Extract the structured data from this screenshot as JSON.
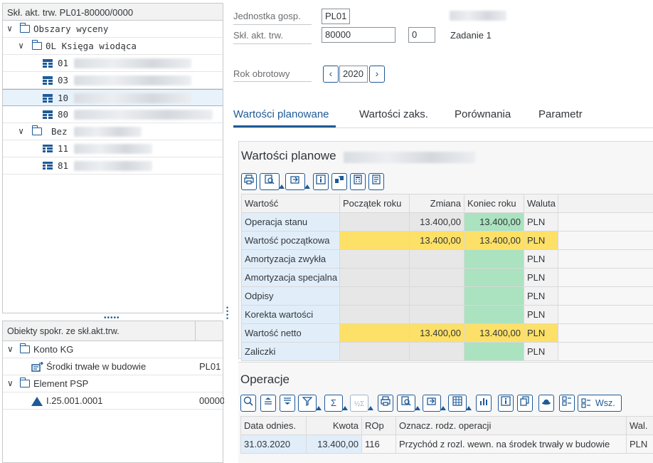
{
  "left": {
    "tree_header": "Skł. akt. trw. PL01-80000/0000",
    "tree": [
      {
        "twisty": "∨",
        "label": "Obszary wyceny"
      },
      {
        "twisty": "∨",
        "label": "0L Księga wiodąca"
      },
      {
        "label": "01"
      },
      {
        "label": "03"
      },
      {
        "label": "10",
        "selected": true
      },
      {
        "label": "80"
      },
      {
        "twisty": "∨",
        "label": "Bez"
      },
      {
        "label": "11"
      },
      {
        "label": "81"
      }
    ],
    "objects_header": "Obiekty spokr. ze skł.akt.trw.",
    "objects": [
      {
        "twisty": "∨",
        "label": "Konto KG"
      },
      {
        "label": "Środki trwałe w budowie",
        "value": "PL01"
      },
      {
        "twisty": "∨",
        "label": "Element PSP"
      },
      {
        "label": "I.25.001.0001",
        "value": "00000"
      }
    ]
  },
  "header": {
    "company_label": "Jednostka gosp.",
    "company_value": "PL01",
    "asset_label": "Skł. akt. trw.",
    "asset_value": "80000",
    "sub_value": "0",
    "task_label": "Zadanie 1",
    "year_label": "Rok obrotowy",
    "year_value": "2020",
    "prev_icon": "chevron-left-icon",
    "next_icon": "chevron-right-icon"
  },
  "tabs": [
    "Wartości planowane",
    "Wartości zaks.",
    "Porównania",
    "Parametr"
  ],
  "planned": {
    "title": "Wartości planowe",
    "columns": [
      "Wartość",
      "Początek roku",
      "Zmiana",
      "Koniec roku",
      "Waluta"
    ],
    "rows": [
      {
        "name": "Operacja stanu",
        "start": "",
        "change": "13.400,00",
        "end": "13.400,00",
        "cur": "PLN",
        "hl": false
      },
      {
        "name": "Wartość początkowa",
        "start": "",
        "change": "13.400,00",
        "end": "13.400,00",
        "cur": "PLN",
        "hl": true
      },
      {
        "name": "Amortyzacja zwykła",
        "start": "",
        "change": "",
        "end": "",
        "cur": "PLN",
        "hl": false
      },
      {
        "name": "Amortyzacja specjalna",
        "start": "",
        "change": "",
        "end": "",
        "cur": "PLN",
        "hl": false
      },
      {
        "name": "Odpisy",
        "start": "",
        "change": "",
        "end": "",
        "cur": "PLN",
        "hl": false
      },
      {
        "name": "Korekta wartości",
        "start": "",
        "change": "",
        "end": "",
        "cur": "PLN",
        "hl": false
      },
      {
        "name": "Wartość netto",
        "start": "",
        "change": "13.400,00",
        "end": "13.400,00",
        "cur": "PLN",
        "hl": true
      },
      {
        "name": "Zaliczki",
        "start": "",
        "change": "",
        "end": "",
        "cur": "PLN",
        "hl": false
      }
    ]
  },
  "operations": {
    "title": "Operacje",
    "toolbar_text_button": "Wsz.",
    "columns": [
      "Data odnies.",
      "Kwota",
      "ROp",
      "Oznacz. rodz. operacji",
      "Wal."
    ],
    "rows": [
      {
        "date": "31.03.2020",
        "amount": "13.400,00",
        "rop": "116",
        "desc": "Przychód z rozl. wewn. na środek trwały w budowie",
        "cur": "PLN"
      }
    ]
  },
  "colors": {
    "accent": "#1f5a96",
    "key_cell": "#e1eefa",
    "highlight": "#fde067",
    "end_cell": "#abe2bf"
  }
}
